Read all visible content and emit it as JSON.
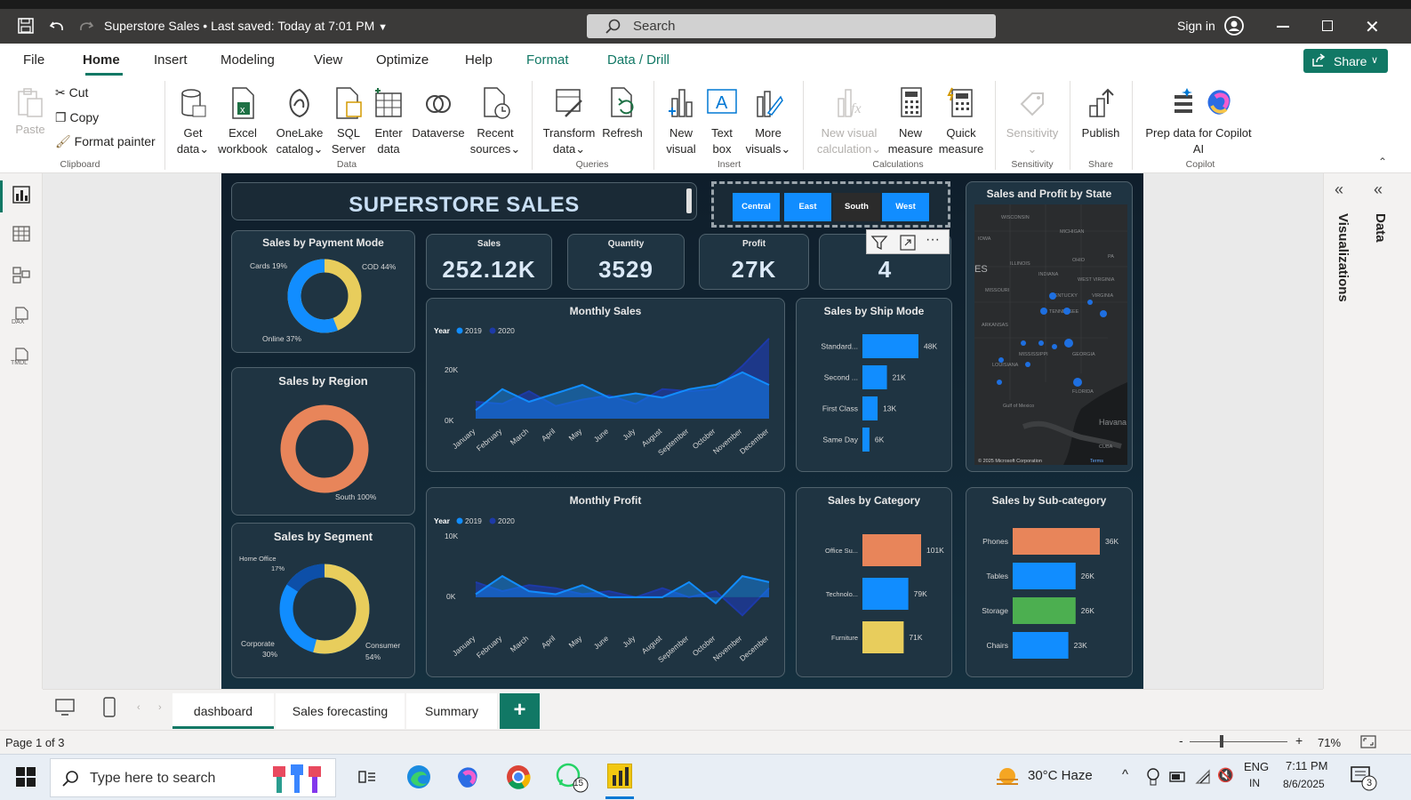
{
  "titlebar": {
    "doc_title": "Superstore Sales",
    "saved_status": "Last saved: Today at 7:01 PM",
    "search_placeholder": "Search",
    "sign_in": "Sign in"
  },
  "menu": {
    "items": [
      "File",
      "Home",
      "Insert",
      "Modeling",
      "View",
      "Optimize",
      "Help",
      "Format",
      "Data / Drill"
    ],
    "share": "Share"
  },
  "ribbon": {
    "clipboard": {
      "paste": "Paste",
      "cut": "Cut",
      "copy": "Copy",
      "format_painter": "Format painter",
      "group": "Clipboard"
    },
    "data": {
      "get_data_1": "Get",
      "get_data_2": "data",
      "excel_1": "Excel",
      "excel_2": "workbook",
      "onelake_1": "OneLake",
      "onelake_2": "catalog",
      "sql_1": "SQL",
      "sql_2": "Server",
      "enter_1": "Enter",
      "enter_2": "data",
      "dataverse": "Dataverse",
      "recent_1": "Recent",
      "recent_2": "sources",
      "group": "Data"
    },
    "queries": {
      "transform_1": "Transform",
      "transform_2": "data",
      "refresh": "Refresh",
      "group": "Queries"
    },
    "insert": {
      "newvisual_1": "New",
      "newvisual_2": "visual",
      "textbox_1": "Text",
      "textbox_2": "box",
      "more_1": "More",
      "more_2": "visuals",
      "group": "Insert"
    },
    "calculations": {
      "nvc_1": "New visual",
      "nvc_2": "calculation",
      "nm_1": "New",
      "nm_2": "measure",
      "qm_1": "Quick",
      "qm_2": "measure",
      "group": "Calculations"
    },
    "sensitivity": {
      "label": "Sensitivity",
      "group": "Sensitivity"
    },
    "share": {
      "publish": "Publish",
      "group": "Share"
    },
    "copilot": {
      "prep_1": "Prep data for Copilot",
      "prep_2": "AI",
      "copilot": "Copilot",
      "group": "Copilot"
    }
  },
  "report": {
    "title": "SUPERSTORE SALES",
    "slicer": [
      "Central",
      "East",
      "South",
      "West"
    ],
    "kpis": [
      {
        "label": "Sales",
        "value": "252.12K"
      },
      {
        "label": "Quantity",
        "value": "3529"
      },
      {
        "label": "Profit",
        "value": "27K"
      },
      {
        "label": "S",
        "value": "4"
      }
    ],
    "payment": {
      "title": "Sales by Payment Mode",
      "cards": "Cards 19%",
      "cod": "COD 44%",
      "online": "Online 37%"
    },
    "region": {
      "title": "Sales by Region",
      "south": "South 100%"
    },
    "segment": {
      "title": "Sales by Segment",
      "home_1": "Home Office",
      "home_2": "17%",
      "corp_1": "Corporate",
      "corp_2": "30%",
      "cons_1": "Consumer",
      "cons_2": "54%"
    },
    "monthly_sales": {
      "title": "Monthly Sales",
      "legend_year": "Year",
      "legend_a": "2019",
      "legend_b": "2020",
      "y_top": "20K",
      "y_bottom": "0K"
    },
    "monthly_profit": {
      "title": "Monthly Profit",
      "legend_year": "Year",
      "legend_a": "2019",
      "legend_b": "2020",
      "y_top": "10K",
      "y_bottom": "0K"
    },
    "months": [
      "January",
      "February",
      "March",
      "April",
      "May",
      "June",
      "July",
      "August",
      "September",
      "October",
      "November",
      "December"
    ],
    "ship": {
      "title": "Sales by Ship Mode"
    },
    "category": {
      "title": "Sales by Category"
    },
    "subcategory": {
      "title": "Sales by Sub-category"
    },
    "map": {
      "title": "Sales and Profit by State",
      "credit": "© 2025 Microsoft Corporation",
      "terms": "Terms",
      "labels": [
        "WISCONSIN",
        "MICHIGAN",
        "IOWA",
        "ILLINOIS",
        "OHIO",
        "PA",
        "INDIANA",
        "WEST VIRGINIA",
        "MISSOURI",
        "KENTUCKY",
        "VIRGINIA",
        "TENNESSEE",
        "ARKANSAS",
        "MISSISSIPPI",
        "GEORGIA",
        "LOUISIANA",
        "FLORIDA",
        "Gulf of Mexico",
        "Havana",
        "CUBA",
        "ES"
      ]
    }
  },
  "chart_data": [
    {
      "type": "pie",
      "title": "Sales by Payment Mode",
      "categories": [
        "Cards",
        "COD",
        "Online"
      ],
      "values": [
        19,
        44,
        37
      ]
    },
    {
      "type": "pie",
      "title": "Sales by Region",
      "categories": [
        "South"
      ],
      "values": [
        100
      ]
    },
    {
      "type": "pie",
      "title": "Sales by Segment",
      "categories": [
        "Home Office",
        "Corporate",
        "Consumer"
      ],
      "values": [
        17,
        30,
        54
      ]
    },
    {
      "type": "area",
      "title": "Monthly Sales",
      "categories": [
        "January",
        "February",
        "March",
        "April",
        "May",
        "June",
        "July",
        "August",
        "September",
        "October",
        "November",
        "December"
      ],
      "series": [
        {
          "name": "2019",
          "values": [
            4000,
            14000,
            8000,
            12000,
            16000,
            10000,
            12000,
            10000,
            14000,
            16000,
            22000,
            16000
          ]
        },
        {
          "name": "2020",
          "values": [
            8000,
            7000,
            13000,
            6000,
            9000,
            11000,
            7000,
            14000,
            13000,
            14000,
            25000,
            38000
          ]
        }
      ],
      "ylim": [
        0,
        40000
      ]
    },
    {
      "type": "area",
      "title": "Monthly Profit",
      "categories": [
        "January",
        "February",
        "March",
        "April",
        "May",
        "June",
        "July",
        "August",
        "September",
        "October",
        "November",
        "December"
      ],
      "series": [
        {
          "name": "2019",
          "values": [
            500,
            3500,
            1000,
            500,
            2000,
            0,
            0,
            0,
            2500,
            -1000,
            3500,
            2500
          ]
        },
        {
          "name": "2020",
          "values": [
            2500,
            1000,
            2000,
            1500,
            500,
            1000,
            0,
            1500,
            0,
            1000,
            -3000,
            1500
          ]
        }
      ],
      "ylim": [
        -4000,
        10000
      ]
    },
    {
      "type": "bar",
      "title": "Sales by Ship Mode",
      "categories": [
        "Standard...",
        "Second ...",
        "First Class",
        "Same Day"
      ],
      "values": [
        48,
        21,
        13,
        6
      ],
      "value_labels": [
        "48K",
        "21K",
        "13K",
        "6K"
      ],
      "colors": [
        "#118dff",
        "#118dff",
        "#118dff",
        "#118dff"
      ]
    },
    {
      "type": "bar",
      "title": "Sales by Category",
      "categories": [
        "Office Su...",
        "Technolo...",
        "Furniture"
      ],
      "values": [
        101,
        79,
        71
      ],
      "value_labels": [
        "101K",
        "79K",
        "71K"
      ],
      "colors": [
        "#e8855a",
        "#118dff",
        "#e8cd5c"
      ]
    },
    {
      "type": "bar",
      "title": "Sales by Sub-category",
      "categories": [
        "Phones",
        "Tables",
        "Storage",
        "Chairs"
      ],
      "values": [
        36,
        26,
        26,
        23
      ],
      "value_labels": [
        "36K",
        "26K",
        "26K",
        "23K"
      ],
      "colors": [
        "#e8855a",
        "#118dff",
        "#4caf50",
        "#118dff"
      ]
    }
  ],
  "pages": {
    "tabs": [
      "dashboard",
      "Sales forecasting",
      "Summary"
    ],
    "active": "dashboard"
  },
  "rightpane": {
    "visualizations": "Visualizations",
    "data": "Data"
  },
  "status": {
    "page": "Page 1 of 3",
    "zoom": "71%"
  },
  "taskbar": {
    "search": "Type here to search",
    "weather": "30°C  Haze",
    "lang_1": "ENG",
    "lang_2": "IN",
    "time": "7:11 PM",
    "date": "8/6/2025",
    "whatsapp_badge": "15",
    "notif": "3"
  },
  "colors": {
    "accent": "#118dff",
    "orange": "#e8855a",
    "yellow": "#e8cd5c",
    "green": "#4caf50",
    "bg_dark": "#15303f",
    "format_tab": "#117865"
  }
}
